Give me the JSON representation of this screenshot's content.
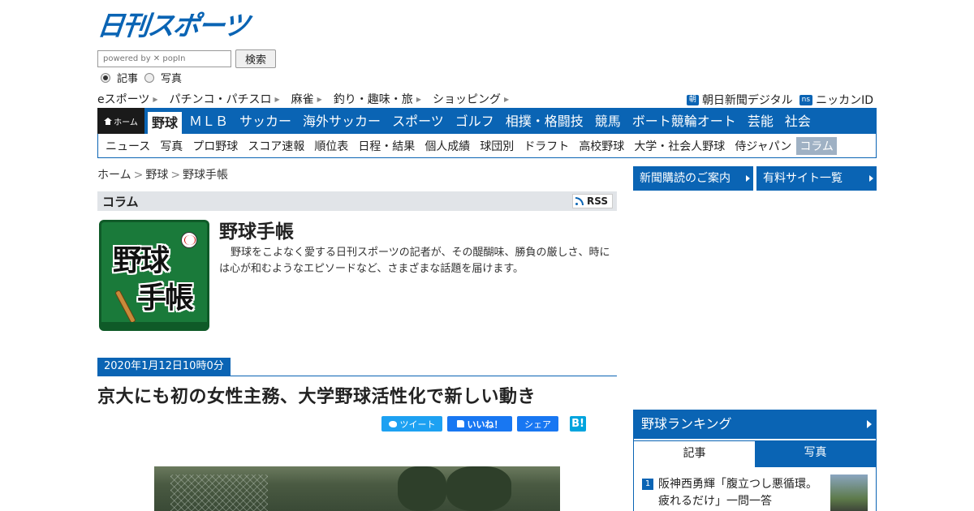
{
  "logo": {
    "text": "日刊スポーツ"
  },
  "search": {
    "placeholder": "powered by ✕ popIn",
    "button": "検索",
    "options": [
      "記事",
      "写真"
    ],
    "selected": "記事"
  },
  "sublinks": [
    "eスポーツ",
    "パチンコ・パチスロ",
    "麻雀",
    "釣り・趣味・旅",
    "ショッピング"
  ],
  "right_links": [
    {
      "badge": "朝",
      "label": "朝日新聞デジタル"
    },
    {
      "badge": "ns",
      "label": "ニッカンID"
    }
  ],
  "mainnav": {
    "home": "ホーム",
    "items": [
      "野球",
      "ＭＬＢ",
      "サッカー",
      "海外サッカー",
      "スポーツ",
      "ゴルフ",
      "相撲・格闘技",
      "競馬",
      "ボート競輪オート",
      "芸能",
      "社会"
    ],
    "active": "野球"
  },
  "subnav": {
    "items": [
      "ニュース",
      "写真",
      "プロ野球",
      "スコア速報",
      "順位表",
      "日程・結果",
      "個人成績",
      "球団別",
      "ドラフト",
      "高校野球",
      "大学・社会人野球",
      "侍ジャパン",
      "コラム"
    ],
    "active": "コラム"
  },
  "breadcrumb": [
    "ホーム",
    "野球",
    "野球手帳"
  ],
  "column": {
    "section": "コラム",
    "rss": "RSS",
    "thumb_text_1": "野球",
    "thumb_text_2": "手帳",
    "title": "野球手帳",
    "description": "野球をこよなく愛する日刊スポーツの記者が、その醍醐味、勝負の厳しさ、時には心が和むようなエピソードなど、さまざまな話題を届けます。"
  },
  "article": {
    "date": "2020年1月12日10時0分",
    "headline": "京大にも初の女性主務、大学野球活性化で新しい動き",
    "share": {
      "tweet": "ツイート",
      "like": "いいね！",
      "share": "シェア",
      "hatena": "B!"
    }
  },
  "sidebar": {
    "buttons": [
      "新聞購読のご案内",
      "有料サイト一覧"
    ],
    "ranking": {
      "title": "野球ランキング",
      "tabs": [
        "記事",
        "写真"
      ],
      "active_tab": "記事",
      "items": [
        {
          "rank": "1",
          "text": "阪神西勇輝「腹立つし悪循環。疲れるだけ」一問一答"
        }
      ]
    }
  },
  "colors": {
    "brand": "#0a64b4",
    "home_bg": "#1a1a1a",
    "subnav_active": "#9fb1c4"
  }
}
